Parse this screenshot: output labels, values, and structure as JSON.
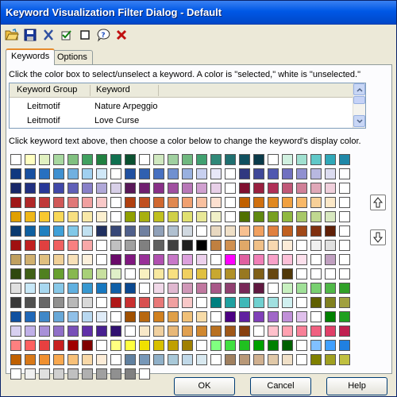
{
  "window": {
    "title": "Keyword Visualization Filter Dialog - Default"
  },
  "toolbar": {
    "icons": [
      "open-folder-icon",
      "save-icon",
      "cut-icon",
      "check-icon",
      "square-icon",
      "help-icon",
      "close-x-icon"
    ]
  },
  "tabs": [
    {
      "label": "Keywords",
      "active": true
    },
    {
      "label": "Options",
      "active": false
    }
  ],
  "keywords": {
    "instruction": "Click the color box to select/unselect a keyword.  A color is \"selected,\" white is \"unselected.\"",
    "columns": [
      "Keyword Group",
      "Keyword"
    ],
    "rows": [
      {
        "group": "Leitmotif",
        "keyword": "Nature Arpeggio"
      },
      {
        "group": "Leitmotif",
        "keyword": "Love Curse"
      }
    ]
  },
  "colors": {
    "instruction": "Click keyword text above, then choose a color below to change the keyword's display color.",
    "swatches": [
      [
        "#ffffff",
        "#ffffc0",
        "#e0f0c0",
        "#a8d8a0",
        "#80c080",
        "#40a060",
        "#208040",
        "#107050",
        "#0a5030",
        "#ffffff",
        "#d0e8c0",
        "#a0d0a0",
        "#70b880",
        "#40a070",
        "#308878",
        "#1f6f70",
        "#105060",
        "#0a3a4a",
        "#ffffff",
        "#d0f0e0",
        "#a0e0d0",
        "#60c8c8",
        "#30a8b8",
        "#1f88a8"
      ],
      [
        "#103880",
        "#1850a0",
        "#2870c0",
        "#4090d0",
        "#70b0e0",
        "#a0d0f0",
        "#d0e8f8",
        "#ffffff",
        "#2050a0",
        "#3060b0",
        "#4870c0",
        "#7090d0",
        "#98b0e0",
        "#c8d0f0",
        "#e8e8f8",
        "#ffffff",
        "#303880",
        "#404898",
        "#5058b0",
        "#7070c0",
        "#9090d0",
        "#b8b8e0",
        "#dcdcf0",
        "#ffffff"
      ],
      [
        "#182868",
        "#203080",
        "#283898",
        "#4048a8",
        "#6060b8",
        "#8880c8",
        "#b0a8d8",
        "#d8d0e8",
        "#581858",
        "#702070",
        "#883088",
        "#a050a0",
        "#b878b8",
        "#d0a0d0",
        "#e8d0e8",
        "#ffffff",
        "#801030",
        "#982040",
        "#b03058",
        "#c05878",
        "#d08098",
        "#e0a8b8",
        "#f0d0dc",
        "#ffffff"
      ],
      [
        "#a01818",
        "#b02828",
        "#c03838",
        "#d05858",
        "#e07878",
        "#f0a0a0",
        "#f8c8c8",
        "#ffffff",
        "#b04010",
        "#c05020",
        "#d06830",
        "#e08850",
        "#f0a070",
        "#f8c0a0",
        "#fce0d0",
        "#ffffff",
        "#c06000",
        "#d07010",
        "#e08820",
        "#f0a040",
        "#f8b868",
        "#f8d098",
        "#fce8c8",
        "#ffffff"
      ],
      [
        "#e0a000",
        "#f0b818",
        "#f8c830",
        "#f8d858",
        "#f8e080",
        "#f8e8a8",
        "#fcf0d0",
        "#ffffff",
        "#90a000",
        "#a8b010",
        "#c0c020",
        "#d0d048",
        "#e0e070",
        "#e8e898",
        "#f0f0c8",
        "#ffffff",
        "#507000",
        "#608810",
        "#78a020",
        "#90b840",
        "#a8c868",
        "#c0d890",
        "#d8e8c0",
        "#ffffff"
      ],
      [
        "#0a3a70",
        "#1060a0",
        "#2080c0",
        "#40a0d8",
        "#80c8e8",
        "#c0e0f0",
        "#203060",
        "#384878",
        "#50608c",
        "#7080a0",
        "#90a0b8",
        "#b0c0d0",
        "#d0d8e0",
        "#ffffff",
        "#e8d8c0",
        "#f0e0c8",
        "#f8c090",
        "#f0a060",
        "#e08040",
        "#c06020",
        "#a04818",
        "#803010",
        "#602008",
        "#ffffff"
      ],
      [
        "#a01010",
        "#c02020",
        "#e04040",
        "#f06060",
        "#f88080",
        "#f8a8a8",
        "#ffffff",
        "#c0c0c0",
        "#a0a0a0",
        "#808080",
        "#606060",
        "#404040",
        "#202020",
        "#000000",
        "#c08040",
        "#d09050",
        "#e0a868",
        "#f0c088",
        "#f8d8b0",
        "#fcecd8",
        "#ffffff",
        "#f0f0f0",
        "#e0e0e0",
        "#ffffff"
      ],
      [
        "#c0a060",
        "#d0b070",
        "#e0c080",
        "#f0d098",
        "#f8e0b8",
        "#fcf0dc",
        "#ffffff",
        "#6a0a6a",
        "#801880",
        "#983098",
        "#b050b0",
        "#c878c8",
        "#dca0dc",
        "#ecd0ec",
        "#ffffff",
        "#ff00ff",
        "#e060a0",
        "#f080b8",
        "#f8a0c8",
        "#fcc0d8",
        "#fce0ec",
        "#ffffff",
        "#c0a0c0",
        "#ffffff"
      ],
      [
        "#304810",
        "#406018",
        "#508020",
        "#68a030",
        "#88b850",
        "#a8d078",
        "#c8e0a0",
        "#e0f0c8",
        "#ffffff",
        "#f8f0c0",
        "#f8e8a0",
        "#f8e080",
        "#f0d060",
        "#e0c040",
        "#c8a830",
        "#b09028",
        "#987820",
        "#806018",
        "#684810",
        "#503808",
        "#ffffff",
        "#ffffff",
        "#ffffff",
        "#ffffff"
      ],
      [
        "#e0e0e0",
        "#c8e8f8",
        "#a8d8f0",
        "#88c8e8",
        "#60b0e0",
        "#3898d0",
        "#1878c0",
        "#1060a8",
        "#0a4890",
        "#ffffff",
        "#f0d8e8",
        "#e0b8d0",
        "#d098b8",
        "#c078a0",
        "#a85888",
        "#904070",
        "#782858",
        "#601840",
        "#ffffff",
        "#c8f0c0",
        "#a0e098",
        "#78d070",
        "#50b848",
        "#30a028"
      ],
      [
        "#383838",
        "#505050",
        "#686868",
        "#909090",
        "#b8b8b8",
        "#d8d8d8",
        "#ffffff",
        "#b01818",
        "#c83030",
        "#d85050",
        "#e87878",
        "#f0a0a0",
        "#f8c8c8",
        "#ffffff",
        "#008080",
        "#20a0a0",
        "#40b8b8",
        "#70d0d0",
        "#a0e0e0",
        "#d0f0f0",
        "#ffffff",
        "#606000",
        "#808020",
        "#a0a040"
      ],
      [
        "#1050a0",
        "#2068b8",
        "#4088c8",
        "#68a8d8",
        "#90c0e8",
        "#b8d8f0",
        "#e0ecf8",
        "#ffffff",
        "#a05000",
        "#b86810",
        "#d08020",
        "#e0a048",
        "#f0c078",
        "#f8dca8",
        "#ffffff",
        "#4b0082",
        "#6020a0",
        "#8040b8",
        "#a068c8",
        "#c090d8",
        "#e0c0ec",
        "#ffffff",
        "#008000",
        "#20a020"
      ],
      [
        "#d8d0f0",
        "#c0b0e8",
        "#a890d8",
        "#9070c8",
        "#7850b8",
        "#6030a8",
        "#482090",
        "#301070",
        "#ffffff",
        "#f8e8c8",
        "#f0d0a0",
        "#e8b878",
        "#e0a050",
        "#d08830",
        "#b87020",
        "#a05818",
        "#884010",
        "#ffffff",
        "#ffc0cb",
        "#ffa0b0",
        "#f88098",
        "#f06080",
        "#e04068",
        "#c02050"
      ],
      [
        "#ff8080",
        "#ff6060",
        "#e84040",
        "#c82020",
        "#a00000",
        "#800000",
        "#ffffff",
        "#ffff80",
        "#ffff40",
        "#f0e000",
        "#d8c000",
        "#c0a000",
        "#a08000",
        "#ffffff",
        "#80ff80",
        "#40e040",
        "#20c020",
        "#00a000",
        "#008000",
        "#006000",
        "#ffffff",
        "#80c0ff",
        "#40a0ff",
        "#2080e0"
      ],
      [
        "#c06000",
        "#d87818",
        "#f09030",
        "#f8a850",
        "#f8c078",
        "#f8d8a8",
        "#fcecd8",
        "#ffffff",
        "#6080a0",
        "#7898b8",
        "#90b0c8",
        "#a8c8d8",
        "#c0d8e8",
        "#d8e8f0",
        "#ffffff",
        "#a08060",
        "#b89878",
        "#d0b090",
        "#e0c8a8",
        "#f0e0c8",
        "#ffffff",
        "#808000",
        "#a0a020",
        "#c0c040"
      ],
      [
        "#ffffff",
        "#f0f0f0",
        "#e0e0e0",
        "#d0d0d0",
        "#c0c0c0",
        "#b0b0b0",
        "#a0a0a0",
        "#909090",
        "#808080",
        "#ffffff"
      ]
    ]
  },
  "buttons": {
    "ok": "OK",
    "cancel": "Cancel",
    "help": "Help"
  }
}
